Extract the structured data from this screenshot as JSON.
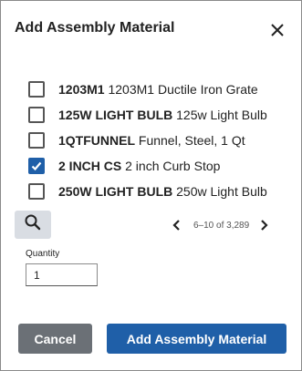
{
  "dialog": {
    "title": "Add Assembly Material",
    "close_icon": "close-icon"
  },
  "items": [
    {
      "code": "1203M1",
      "description": "1203M1 Ductile Iron Grate",
      "checked": false
    },
    {
      "code": "125W LIGHT BULB",
      "description": "125w Light Bulb",
      "checked": false
    },
    {
      "code": "1QTFUNNEL",
      "description": "Funnel, Steel, 1 Qt",
      "checked": false
    },
    {
      "code": "2 INCH CS",
      "description": "2 inch Curb Stop",
      "checked": true
    },
    {
      "code": "250W LIGHT BULB",
      "description": "250w Light Bulb",
      "checked": false
    }
  ],
  "search": {
    "icon": "search-icon"
  },
  "pagination": {
    "range_text": "6–10 of 3,289",
    "prev_icon": "chevron-left-icon",
    "next_icon": "chevron-right-icon"
  },
  "quantity": {
    "label": "Quantity",
    "value": "1"
  },
  "actions": {
    "cancel_label": "Cancel",
    "add_label": "Add Assembly Material"
  },
  "colors": {
    "primary": "#1f5fa8",
    "cancel": "#6b7076",
    "search_bg": "#d9dde3"
  }
}
